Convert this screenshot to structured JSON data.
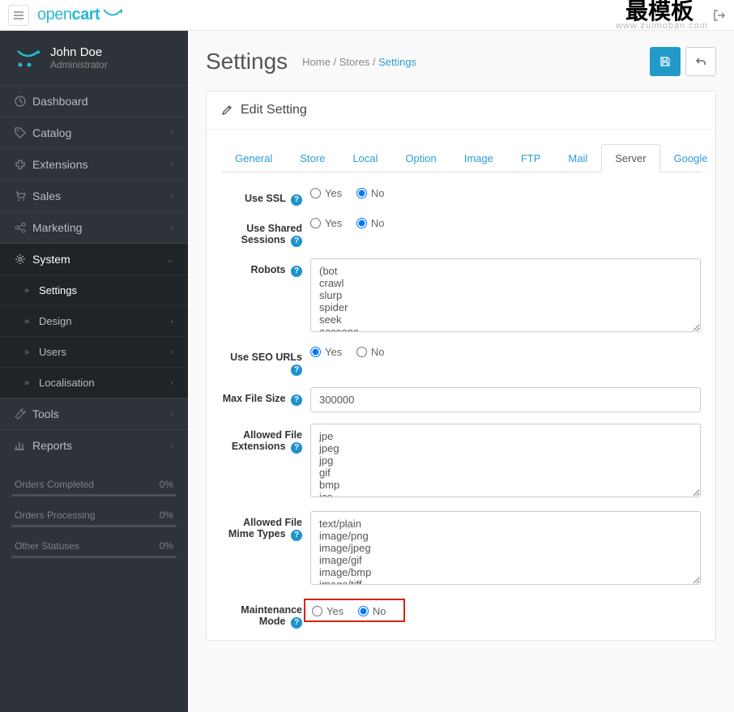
{
  "brand": {
    "name_a": "open",
    "name_b": "cart"
  },
  "watermark": {
    "main": "最模板",
    "sub": "www.zuimoban.com"
  },
  "user": {
    "name": "John Doe",
    "role": "Administrator"
  },
  "nav": {
    "dashboard": "Dashboard",
    "catalog": "Catalog",
    "extensions": "Extensions",
    "sales": "Sales",
    "marketing": "Marketing",
    "system": "System",
    "tools": "Tools",
    "reports": "Reports",
    "sub": {
      "settings": "Settings",
      "design": "Design",
      "users": "Users",
      "localisation": "Localisation"
    }
  },
  "stats": {
    "completed": {
      "label": "Orders Completed",
      "value": "0%"
    },
    "processing": {
      "label": "Orders Processing",
      "value": "0%"
    },
    "other": {
      "label": "Other Statuses",
      "value": "0%"
    }
  },
  "page": {
    "title": "Settings"
  },
  "breadcrumb": {
    "home": "Home",
    "stores": "Stores",
    "current": "Settings",
    "sep": " / "
  },
  "panel": {
    "heading": "Edit Setting"
  },
  "tabs": {
    "general": "General",
    "store": "Store",
    "local": "Local",
    "option": "Option",
    "image": "Image",
    "ftp": "FTP",
    "mail": "Mail",
    "server": "Server",
    "google": "Google"
  },
  "form": {
    "use_ssl": {
      "label": "Use SSL",
      "yes": "Yes",
      "no": "No"
    },
    "shared": {
      "label": "Use Shared Sessions",
      "yes": "Yes",
      "no": "No"
    },
    "robots": {
      "label": "Robots",
      "value": "(bot\ncrawl\nslurp\nspider\nseek\naccoona"
    },
    "seo": {
      "label": "Use SEO URLs",
      "yes": "Yes",
      "no": "No"
    },
    "maxfile": {
      "label": "Max File Size",
      "value": "300000"
    },
    "allowed_ext": {
      "label": "Allowed File Extensions",
      "value": "jpe\njpeg\njpg\ngif\nbmp\nico"
    },
    "allowed_mime": {
      "label": "Allowed File Mime Types",
      "value": "text/plain\nimage/png\nimage/jpeg\nimage/gif\nimage/bmp\nimage/tiff"
    },
    "maintenance": {
      "label": "Maintenance Mode",
      "yes": "Yes",
      "no": "No"
    }
  }
}
